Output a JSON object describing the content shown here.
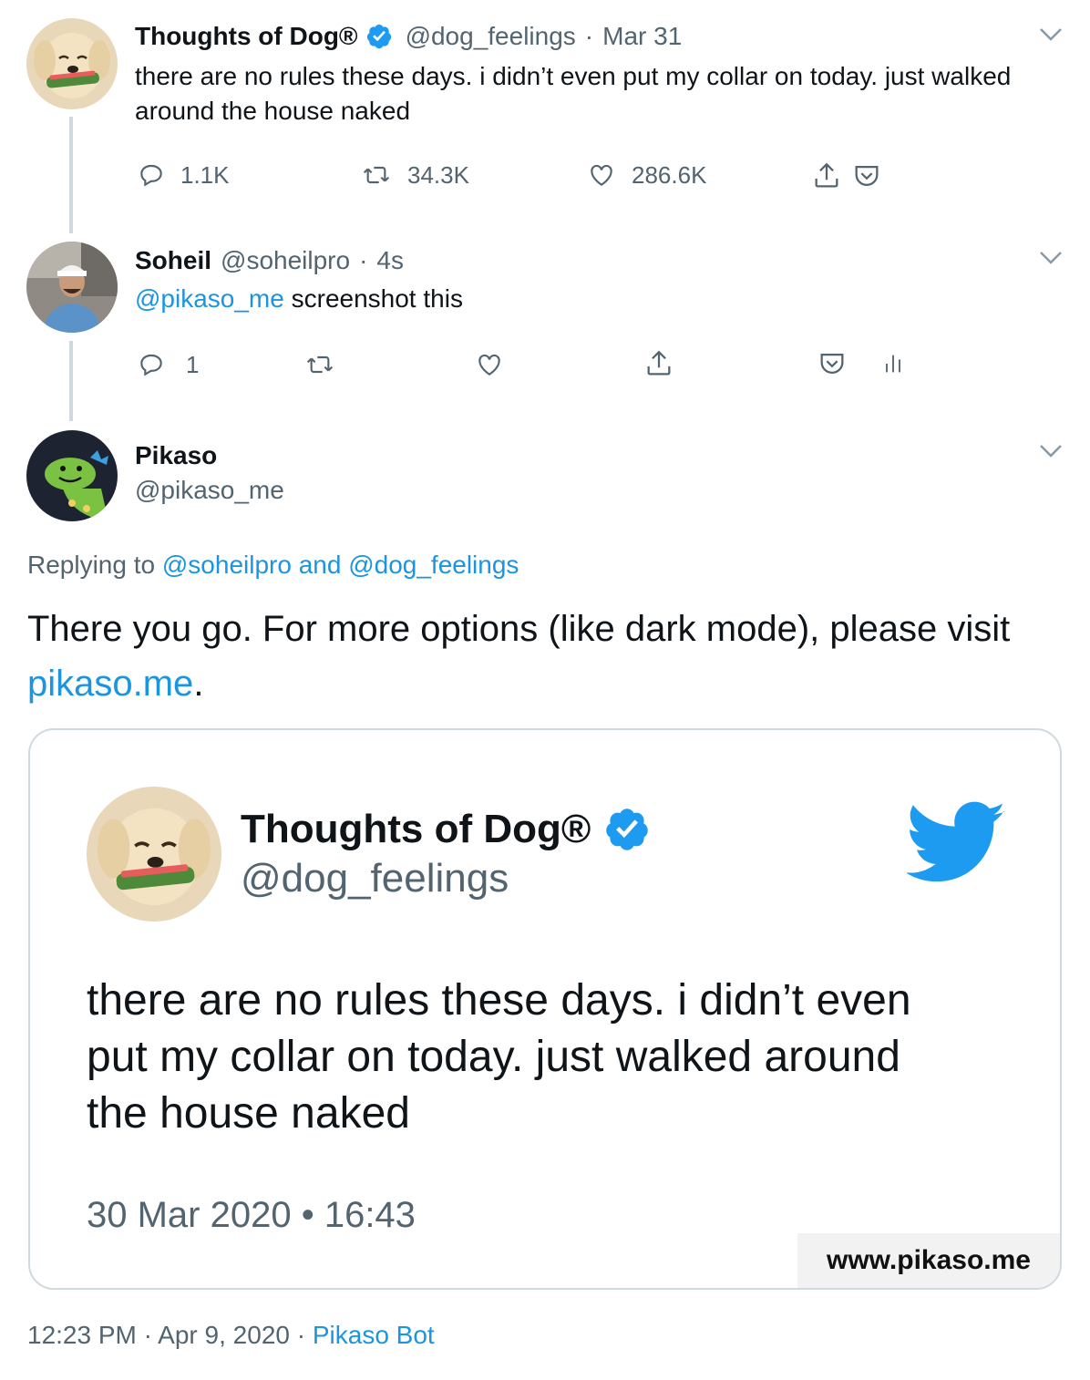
{
  "tweet1": {
    "name": "Thoughts of Dog®",
    "handle": "@dog_feelings",
    "sep": "·",
    "time": "Mar 31",
    "text": "there are no rules these days. i didn’t even put my collar on today. just walked around the house naked",
    "replies": "1.1K",
    "retweets": "34.3K",
    "likes": "286.6K"
  },
  "tweet2": {
    "name": "Soheil",
    "handle": "@soheilpro",
    "sep": "·",
    "time": "4s",
    "mention": "@pikaso_me",
    "text": " screenshot this",
    "replies": "1"
  },
  "tweet3": {
    "name": "Pikaso",
    "handle": "@pikaso_me",
    "replying_prefix": "Replying to ",
    "replying_to": "@soheilpro and @dog_feelings",
    "text_before": "There you go. For more options (like dark mode), please visit ",
    "link": "pikaso.me",
    "text_after": ".",
    "footer_time": "12:23 PM · Apr 9, 2020 · ",
    "footer_source": "Pikaso Bot"
  },
  "card": {
    "name": "Thoughts of Dog®",
    "handle": "@dog_feelings",
    "text": "there are no rules these days. i didn’t even put my collar on today. just walked around the house naked",
    "date": "30 Mar 2020 • 16:43",
    "watermark": "www.pikaso.me"
  },
  "colors": {
    "link": "#1b95e0",
    "verified": "#1d9bf0",
    "twitter_bird": "#1d9bf0",
    "muted": "#536471",
    "thread_line": "#cfd9de"
  },
  "icons": [
    "reply-icon",
    "retweet-icon",
    "like-icon",
    "share-icon",
    "pocket-icon",
    "analytics-icon",
    "chevron-down-icon",
    "verified-icon",
    "twitter-bird-icon"
  ]
}
